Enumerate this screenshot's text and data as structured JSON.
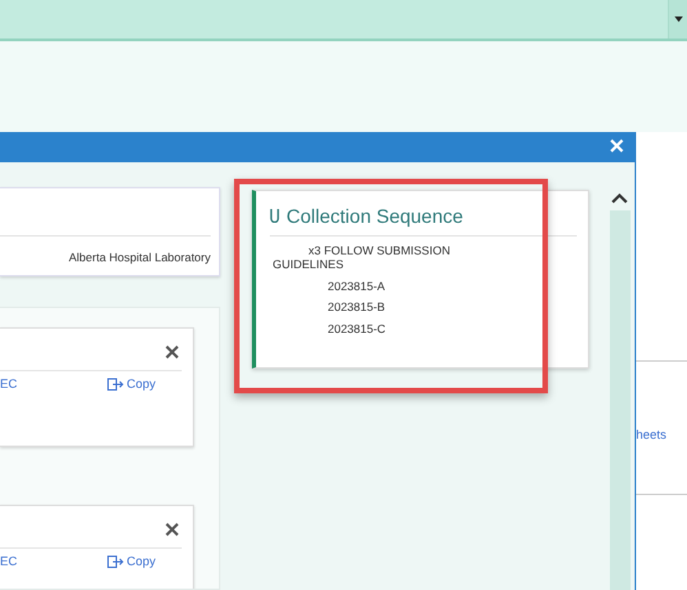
{
  "lab_card": {
    "text": "Alberta Hospital Laboratory"
  },
  "order_cards": [
    {
      "code": "EC",
      "action": "Copy"
    },
    {
      "code": "EC",
      "action": "Copy"
    }
  ],
  "collection_sequence": {
    "title": "Collection Sequence",
    "lines": [
      "x3 FOLLOW SUBMISSION GUIDELINES",
      "2023815-A",
      "2023815-B",
      "2023815-C"
    ],
    "highlighted": true
  },
  "side_link": "heets"
}
